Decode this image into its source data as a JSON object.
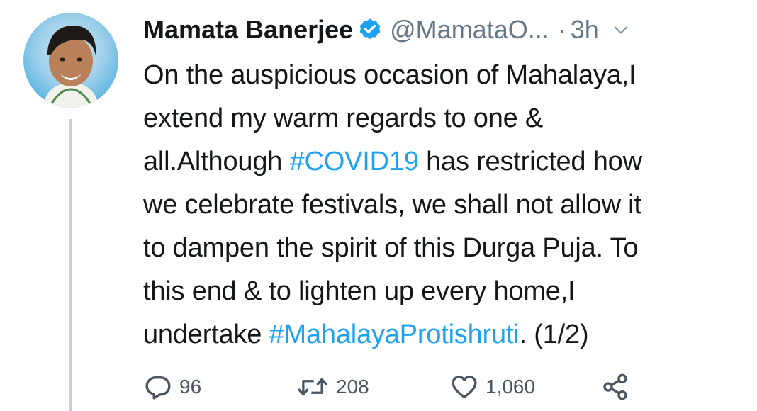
{
  "tweet": {
    "author_name": "Mamata Banerjee",
    "handle": "@MamataO...",
    "separator": "·",
    "time": "3h",
    "text_lines": [
      [
        {
          "text": "On the auspicious occasion of Mahalaya,I"
        }
      ],
      [
        {
          "text": "extend my warm regards to one &"
        }
      ],
      [
        {
          "text": "all.Although "
        },
        {
          "text": "#COVID19",
          "tag": true
        },
        {
          "text": " has restricted how"
        }
      ],
      [
        {
          "text": "we celebrate festivals, we shall not allow it"
        }
      ],
      [
        {
          "text": "to dampen the spirit of this Durga Puja. To"
        }
      ],
      [
        {
          "text": "this end & to lighten up every home,I"
        }
      ],
      [
        {
          "text": "undertake "
        },
        {
          "text": "#MahalayaProtishruti",
          "tag": true
        },
        {
          "text": ". (1/2)"
        }
      ]
    ],
    "stats": {
      "replies": "96",
      "retweets": "208",
      "likes": "1,060"
    }
  },
  "icons": {
    "verified": "verified-badge-icon",
    "caret": "chevron-down-icon",
    "reply": "reply-icon",
    "retweet": "retweet-icon",
    "like": "heart-icon",
    "share": "share-icon"
  },
  "colors": {
    "text": "#14171a",
    "muted": "#657786",
    "accent": "#1da1f2",
    "thread_line": "#c4cfd6"
  }
}
